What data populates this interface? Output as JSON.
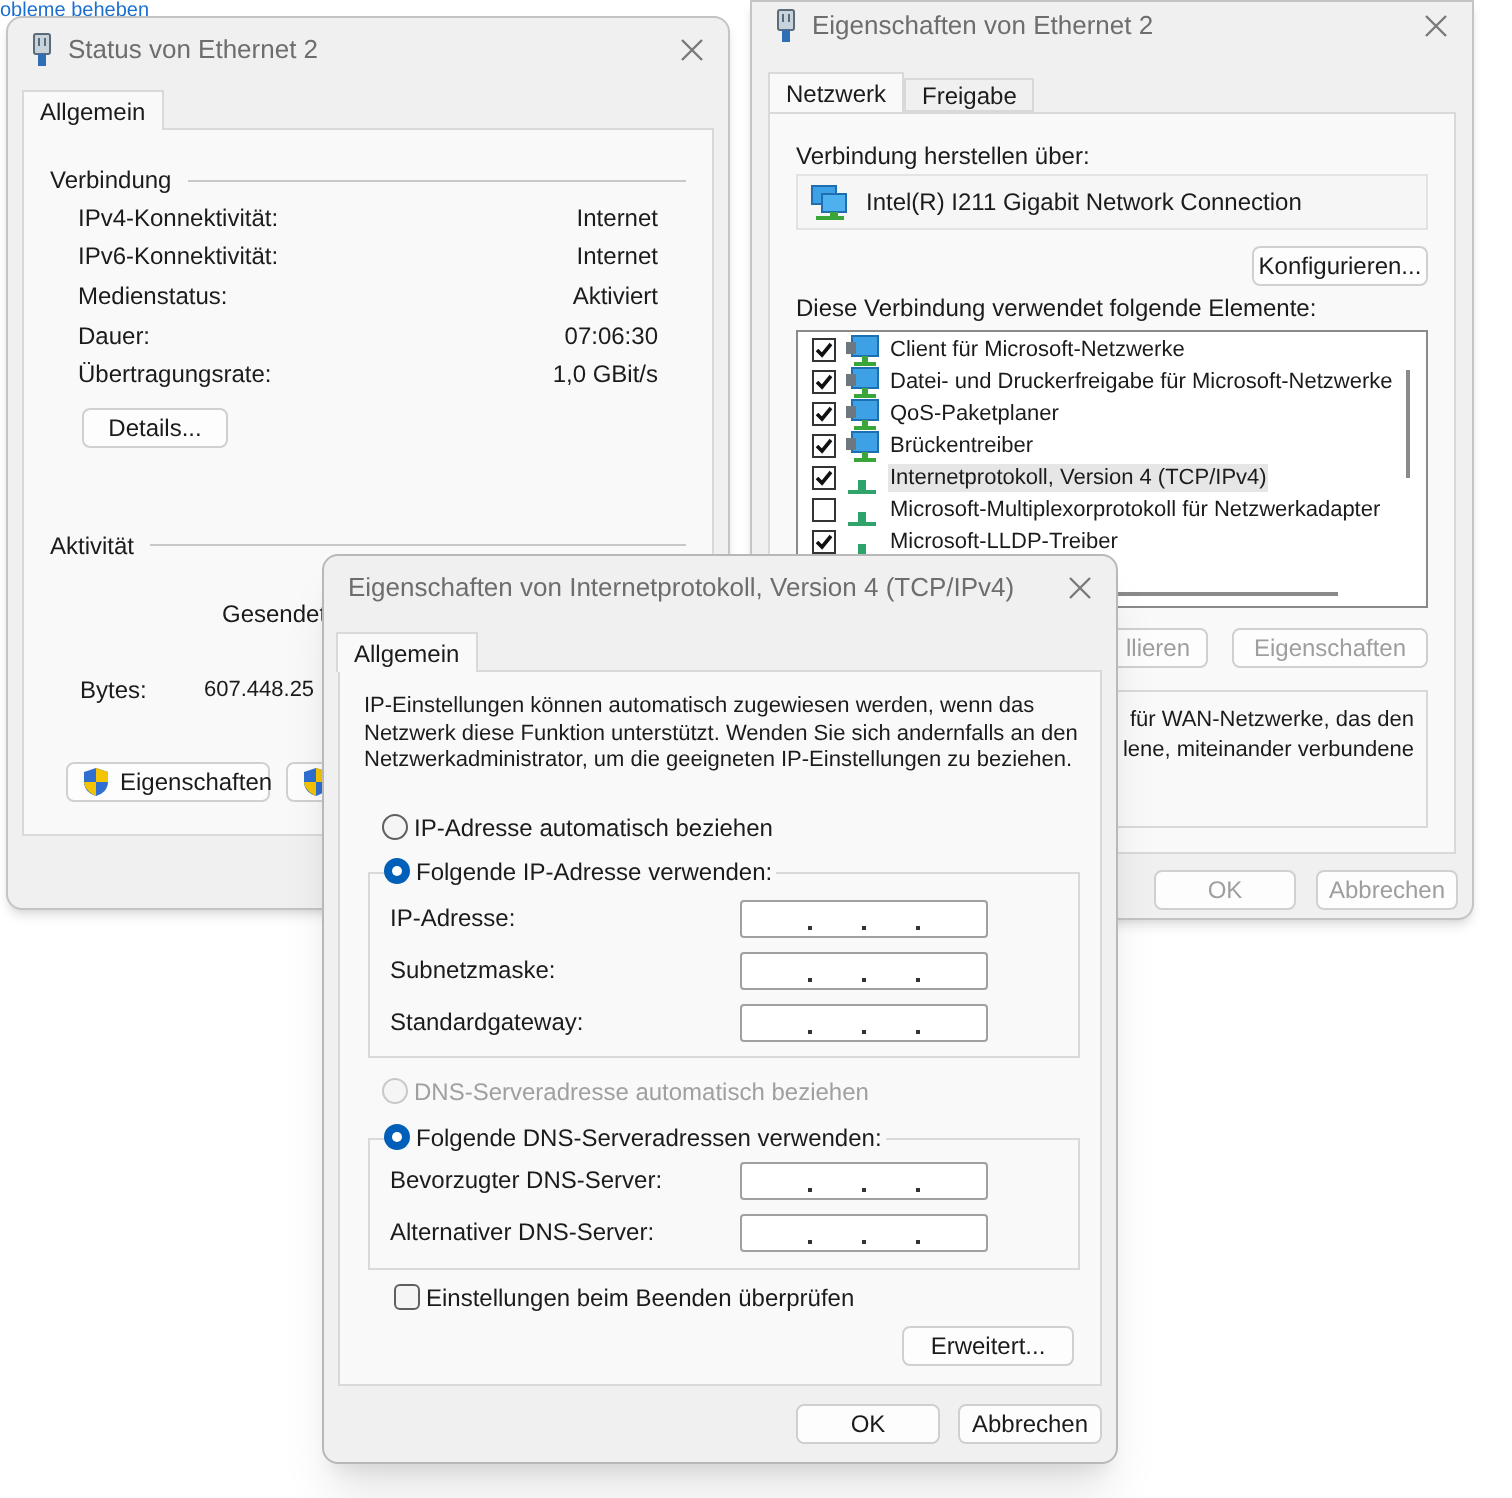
{
  "background_link": {
    "text": "obleme beheben"
  },
  "status_window": {
    "title": "Status von Ethernet 2",
    "tabs": [
      {
        "label": "Allgemein",
        "selected": true
      }
    ],
    "connection_heading": "Verbindung",
    "connection_rows": [
      {
        "label": "IPv4-Konnektivität:",
        "value": "Internet"
      },
      {
        "label": "IPv6-Konnektivität:",
        "value": "Internet"
      },
      {
        "label": "Medienstatus:",
        "value": "Aktiviert"
      },
      {
        "label": "Dauer:",
        "value": "07:06:30"
      },
      {
        "label": "Übertragungsrate:",
        "value": "1,0 GBit/s"
      }
    ],
    "details_button": "Details...",
    "activity_heading": "Aktivität",
    "sent_header": "Gesendet",
    "bytes_label": "Bytes:",
    "bytes_sent": "607.448.25",
    "buttons": [
      {
        "label": "Eigenschaften",
        "shield": true
      },
      {
        "shield": true
      }
    ]
  },
  "ethernet_window": {
    "title": "Eigenschaften von Ethernet 2",
    "tabs": [
      {
        "label": "Netzwerk",
        "selected": true
      },
      {
        "label": "Freigabe",
        "selected": false
      }
    ],
    "connect_via_label": "Verbindung herstellen über:",
    "adapter": "Intel(R) I211 Gigabit Network Connection",
    "configure_button": "Konfigurieren...",
    "elements_label": "Diese Verbindung verwendet folgende Elemente:",
    "elements": [
      {
        "label": "Client für Microsoft-Netzwerke",
        "checked": true,
        "kind": "monitor",
        "selected": false
      },
      {
        "label": "Datei- und Druckerfreigabe für Microsoft-Netzwerke",
        "checked": true,
        "kind": "monitor",
        "selected": false
      },
      {
        "label": "QoS-Paketplaner",
        "checked": true,
        "kind": "monitor",
        "selected": false
      },
      {
        "label": "Brückentreiber",
        "checked": true,
        "kind": "monitor",
        "selected": false
      },
      {
        "label": "Internetprotokoll, Version 4 (TCP/IPv4)",
        "checked": true,
        "kind": "protocol",
        "selected": true
      },
      {
        "label": "Microsoft-Multiplexorprotokoll für Netzwerkadapter",
        "checked": false,
        "kind": "protocol",
        "selected": false
      },
      {
        "label": "Microsoft-LLDP-Treiber",
        "checked": true,
        "kind": "protocol",
        "selected": false
      }
    ],
    "buttons": [
      {
        "label": "llieren",
        "disabled": true
      },
      {
        "label": "Eigenschaften",
        "disabled": true
      }
    ],
    "description_lines": [
      "für WAN-Netzwerke, das den",
      "lene, miteinander verbundene"
    ],
    "footer_buttons": [
      "OK",
      "Abbrechen"
    ]
  },
  "ipv4_dialog": {
    "title": "Eigenschaften von Internetprotokoll, Version 4 (TCP/IPv4)",
    "tabs": [
      {
        "label": "Allgemein",
        "selected": true
      }
    ],
    "intro": "IP-Einstellungen können automatisch zugewiesen werden, wenn das Netzwerk diese Funktion unterstützt. Wenden Sie sich andernfalls an den Netzwerkadministrator, um die geeigneten IP-Einstellungen zu beziehen.",
    "ip_options": [
      {
        "label": "IP-Adresse automatisch beziehen",
        "selected": false,
        "disabled": false
      },
      {
        "label": "Folgende IP-Adresse verwenden:",
        "selected": true,
        "disabled": false
      }
    ],
    "ip_fields": [
      {
        "label": "IP-Adresse:"
      },
      {
        "label": "Subnetzmaske:"
      },
      {
        "label": "Standardgateway:"
      }
    ],
    "dns_options": [
      {
        "label": "DNS-Serveradresse automatisch beziehen",
        "selected": false,
        "disabled": true
      },
      {
        "label": "Folgende DNS-Serveradressen verwenden:",
        "selected": true,
        "disabled": false
      }
    ],
    "dns_fields": [
      {
        "label": "Bevorzugter DNS-Server:"
      },
      {
        "label": "Alternativer DNS-Server:"
      }
    ],
    "validate_checkbox": {
      "label": "Einstellungen beim Beenden überprüfen",
      "checked": false
    },
    "advanced_button": "Erweitert...",
    "footer_buttons": [
      "OK",
      "Abbrechen"
    ]
  }
}
